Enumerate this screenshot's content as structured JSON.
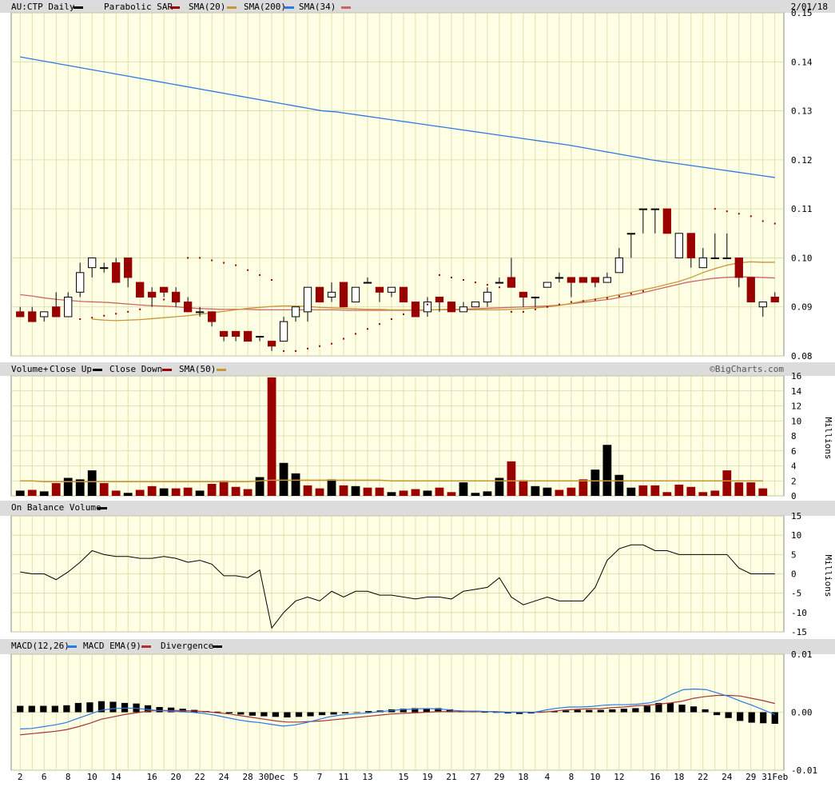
{
  "header": {
    "symbol_label": "AU:CTP Daily",
    "sar_label": "Parabolic SAR",
    "sma20_label": "SMA(20)",
    "sma200_label": "SMA(200)",
    "sma34_label": "SMA(34)",
    "date": "2/01/18"
  },
  "watermark": "©BigCharts.com",
  "colors": {
    "panel_bg": "#ffffe6",
    "grid": "#d8d8a0",
    "header_bg": "#dcdcdc",
    "up": "#000000",
    "down": "#990000",
    "sma20": "#c89632",
    "sma200": "#2a7ae2",
    "sma34": "#d06464",
    "sar": "#990000",
    "macd": "#2a7ae2",
    "macd_ema": "#aa3333"
  },
  "x_ticks": [
    "2",
    "6",
    "8",
    "10",
    "14",
    "16",
    "20",
    "22",
    "24",
    "28",
    "30Dec",
    "5",
    "7",
    "11",
    "13",
    "15",
    "19",
    "21",
    "27",
    "29",
    "18",
    "4",
    "8",
    "10",
    "12",
    "16",
    "18",
    "22",
    "24",
    "29",
    "31Feb"
  ],
  "chart_data": [
    {
      "type": "candlestick",
      "title": "AU:CTP Daily",
      "ylim": [
        0.08,
        0.15
      ],
      "yticks": [
        "0.15",
        "0.14",
        "0.13",
        "0.12",
        "0.11",
        "0.10",
        "0.09",
        "0.08"
      ],
      "ohlc": [
        [
          0.089,
          0.09,
          0.088,
          0.088
        ],
        [
          0.089,
          0.09,
          0.087,
          0.087
        ],
        [
          0.088,
          0.089,
          0.087,
          0.089
        ],
        [
          0.09,
          0.093,
          0.088,
          0.088
        ],
        [
          0.088,
          0.093,
          0.088,
          0.092
        ],
        [
          0.093,
          0.099,
          0.092,
          0.097
        ],
        [
          0.098,
          0.1,
          0.096,
          0.1
        ],
        [
          0.098,
          0.099,
          0.097,
          0.098
        ],
        [
          0.099,
          0.1,
          0.096,
          0.095
        ],
        [
          0.1,
          0.1,
          0.094,
          0.096
        ],
        [
          0.095,
          0.095,
          0.092,
          0.092
        ],
        [
          0.093,
          0.094,
          0.09,
          0.092
        ],
        [
          0.094,
          0.094,
          0.092,
          0.093
        ],
        [
          0.093,
          0.094,
          0.09,
          0.091
        ],
        [
          0.091,
          0.092,
          0.089,
          0.089
        ],
        [
          0.089,
          0.09,
          0.088,
          0.089
        ],
        [
          0.089,
          0.089,
          0.086,
          0.087
        ],
        [
          0.085,
          0.085,
          0.083,
          0.084
        ],
        [
          0.085,
          0.085,
          0.083,
          0.084
        ],
        [
          0.085,
          0.085,
          0.083,
          0.083
        ],
        [
          0.084,
          0.084,
          0.083,
          0.084
        ],
        [
          0.083,
          0.083,
          0.081,
          0.082
        ],
        [
          0.083,
          0.088,
          0.083,
          0.087
        ],
        [
          0.088,
          0.09,
          0.087,
          0.09
        ],
        [
          0.089,
          0.094,
          0.087,
          0.094
        ],
        [
          0.094,
          0.094,
          0.091,
          0.091
        ],
        [
          0.092,
          0.095,
          0.091,
          0.093
        ],
        [
          0.095,
          0.095,
          0.09,
          0.09
        ],
        [
          0.091,
          0.094,
          0.091,
          0.094
        ],
        [
          0.095,
          0.096,
          0.095,
          0.095
        ],
        [
          0.094,
          0.094,
          0.091,
          0.093
        ],
        [
          0.093,
          0.094,
          0.092,
          0.094
        ],
        [
          0.094,
          0.094,
          0.091,
          0.091
        ],
        [
          0.091,
          0.091,
          0.088,
          0.088
        ],
        [
          0.089,
          0.092,
          0.088,
          0.091
        ],
        [
          0.092,
          0.092,
          0.089,
          0.091
        ],
        [
          0.091,
          0.091,
          0.089,
          0.089
        ],
        [
          0.089,
          0.091,
          0.089,
          0.09
        ],
        [
          0.09,
          0.091,
          0.09,
          0.091
        ],
        [
          0.091,
          0.094,
          0.09,
          0.093
        ],
        [
          0.095,
          0.096,
          0.095,
          0.095
        ],
        [
          0.096,
          0.1,
          0.094,
          0.094
        ],
        [
          0.093,
          0.093,
          0.09,
          0.092
        ],
        [
          0.092,
          0.092,
          0.09,
          0.092
        ],
        [
          0.094,
          0.095,
          0.094,
          0.095
        ],
        [
          0.096,
          0.097,
          0.095,
          0.096
        ],
        [
          0.096,
          0.096,
          0.092,
          0.095
        ],
        [
          0.096,
          0.096,
          0.095,
          0.095
        ],
        [
          0.096,
          0.096,
          0.094,
          0.095
        ],
        [
          0.095,
          0.097,
          0.095,
          0.096
        ],
        [
          0.097,
          0.102,
          0.097,
          0.1
        ],
        [
          0.105,
          0.105,
          0.1,
          0.105
        ],
        [
          0.11,
          0.11,
          0.105,
          0.11
        ],
        [
          0.11,
          0.11,
          0.105,
          0.11
        ],
        [
          0.11,
          0.11,
          0.105,
          0.105
        ],
        [
          0.1,
          0.105,
          0.1,
          0.105
        ],
        [
          0.105,
          0.105,
          0.098,
          0.1
        ],
        [
          0.098,
          0.102,
          0.098,
          0.1
        ],
        [
          0.1,
          0.105,
          0.1,
          0.1
        ],
        [
          0.1,
          0.105,
          0.1,
          0.1
        ],
        [
          0.1,
          0.1,
          0.094,
          0.096
        ],
        [
          0.096,
          0.096,
          0.091,
          0.091
        ],
        [
          0.09,
          0.091,
          0.088,
          0.091
        ],
        [
          0.092,
          0.093,
          0.091,
          0.091
        ]
      ],
      "sma200": [
        0.141,
        0.1405,
        0.14,
        0.1395,
        0.139,
        0.1385,
        0.138,
        0.1375,
        0.137,
        0.1365,
        0.136,
        0.1355,
        0.135,
        0.1345,
        0.134,
        0.1335,
        0.133,
        0.1325,
        0.132,
        0.1315,
        0.131,
        0.1305,
        0.13,
        0.1298,
        0.1294,
        0.129,
        0.1286,
        0.1282,
        0.1278,
        0.1274,
        0.127,
        0.1266,
        0.1262,
        0.1258,
        0.1254,
        0.125,
        0.1246,
        0.1242,
        0.1238,
        0.1234,
        0.123,
        0.1225,
        0.122,
        0.1215,
        0.121,
        0.1205,
        0.12,
        0.1196,
        0.1192,
        0.1188,
        0.1184,
        0.118,
        0.1176,
        0.1172,
        0.1168,
        0.1164
      ],
      "sma200_start": 0,
      "sma20": [
        0.0875,
        0.0873,
        0.0872,
        0.0873,
        0.0874,
        0.0876,
        0.0878,
        0.088,
        0.0882,
        0.0885,
        0.0888,
        0.0891,
        0.0894,
        0.0897,
        0.0899,
        0.0901,
        0.0902,
        0.0902,
        0.0901,
        0.0899,
        0.0898,
        0.0897,
        0.0896,
        0.0895,
        0.0895,
        0.0894,
        0.0894,
        0.0894,
        0.0894,
        0.0894,
        0.0894,
        0.0894,
        0.0894,
        0.0894,
        0.0894,
        0.0895,
        0.0896,
        0.0898,
        0.09,
        0.0903,
        0.0907,
        0.0912,
        0.0916,
        0.092,
        0.0925,
        0.093,
        0.0935,
        0.094,
        0.0946,
        0.0952,
        0.096,
        0.097,
        0.0978,
        0.0985,
        0.099,
        0.0992,
        0.0991,
        0.0991
      ],
      "sma20_start": 6,
      "sma34": [
        0.0925,
        0.0922,
        0.0918,
        0.0915,
        0.0913,
        0.0911,
        0.091,
        0.0909,
        0.0907,
        0.0905,
        0.0903,
        0.0902,
        0.0901,
        0.0899,
        0.0897,
        0.0896,
        0.0895,
        0.0895,
        0.0895,
        0.0894,
        0.0894,
        0.0894,
        0.0894,
        0.0894,
        0.0894,
        0.0894,
        0.0893,
        0.0893,
        0.0893,
        0.0893,
        0.0893,
        0.0893,
        0.0893,
        0.0894,
        0.0895,
        0.0895,
        0.0896,
        0.0897,
        0.0898,
        0.0899,
        0.09,
        0.0901,
        0.0902,
        0.0904,
        0.0907,
        0.091,
        0.0913,
        0.0916,
        0.0921,
        0.0926,
        0.0932,
        0.0938,
        0.0944,
        0.095,
        0.0954,
        0.0958,
        0.096,
        0.0961,
        0.0961,
        0.096,
        0.0959
      ],
      "sma34_start": 0,
      "sar": [
        null,
        null,
        null,
        null,
        null,
        0.0875,
        0.0878,
        0.0882,
        0.0886,
        0.089,
        0.0895,
        0.092,
        0.0915,
        0.091,
        0.1,
        0.1,
        0.0995,
        0.099,
        0.0985,
        0.0975,
        0.0965,
        0.0955,
        0.081,
        0.081,
        0.0815,
        0.082,
        0.0825,
        0.0835,
        0.0845,
        0.0855,
        0.0865,
        0.0875,
        0.0885,
        0.0895,
        0.0905,
        0.0965,
        0.096,
        0.0955,
        0.095,
        0.0945,
        0.094,
        0.089,
        0.089,
        0.0895,
        0.09,
        0.0905,
        0.091,
        0.0912,
        0.0915,
        0.0918,
        0.0922,
        0.0927,
        0.0932,
        null,
        null,
        null,
        null,
        null,
        0.11,
        0.1095,
        0.109,
        0.1085,
        0.1075,
        0.107
      ]
    },
    {
      "type": "bar",
      "title": "Volume+",
      "legend": [
        "Close Up",
        "Close Down",
        "SMA(50)"
      ],
      "unit": "Millions",
      "ylim": [
        0,
        16
      ],
      "yticks": [
        "16",
        "14",
        "12",
        "10",
        "8",
        "6",
        "4",
        "2",
        "0"
      ],
      "values": [
        0.7,
        0.8,
        0.6,
        1.7,
        2.4,
        2.2,
        3.4,
        1.7,
        0.7,
        0.4,
        0.8,
        1.3,
        1.0,
        1.0,
        1.1,
        0.7,
        1.6,
        2.0,
        1.2,
        0.9,
        2.5,
        15.8,
        4.4,
        3.0,
        1.4,
        1.0,
        2.2,
        1.4,
        1.3,
        1.1,
        1.1,
        0.5,
        0.7,
        0.9,
        0.7,
        1.1,
        0.5,
        1.8,
        0.4,
        0.6,
        2.4,
        4.6,
        2.1,
        1.3,
        1.1,
        0.8,
        1.1,
        2.2,
        3.5,
        6.8,
        2.8,
        1.1,
        1.4,
        1.4,
        0.5,
        1.5,
        1.2,
        0.5,
        0.7,
        3.4,
        1.8,
        1.8,
        1.0
      ],
      "up": [
        1,
        0,
        1,
        0,
        1,
        1,
        1,
        0,
        0,
        1,
        0,
        0,
        1,
        0,
        0,
        1,
        0,
        0,
        0,
        0,
        1,
        0,
        1,
        1,
        0,
        0,
        1,
        0,
        1,
        0,
        0,
        1,
        0,
        0,
        1,
        0,
        0,
        1,
        1,
        1,
        1,
        0,
        0,
        1,
        1,
        0,
        0,
        0,
        1,
        1,
        1,
        1,
        0,
        0,
        0,
        0,
        0,
        0,
        0,
        0,
        0,
        0,
        0
      ],
      "sma50": [
        2.0,
        2.0,
        1.9,
        1.9,
        1.9,
        1.9,
        1.9,
        1.9,
        1.9,
        1.9,
        1.9,
        1.9,
        1.9,
        1.9,
        1.9,
        1.9,
        1.9,
        1.9,
        1.9,
        1.9,
        2.0,
        2.1,
        2.1,
        2.1,
        2.1,
        2.1,
        2.1,
        2.1,
        2.1,
        2.1,
        2.1,
        2.0,
        2.0,
        2.0,
        2.0,
        2.0,
        2.0,
        2.0,
        2.0,
        2.0,
        2.0,
        2.0,
        2.0,
        2.0,
        2.0,
        2.0,
        2.0,
        2.0,
        2.0,
        2.0,
        2.0,
        2.0,
        2.0,
        2.0,
        2.0,
        2.0,
        2.0,
        2.0,
        2.0,
        2.0,
        2.0,
        2.0,
        2.0
      ]
    },
    {
      "type": "line",
      "title": "On Balance Volume",
      "unit": "Millions",
      "ylim": [
        -15,
        15
      ],
      "yticks": [
        "15",
        "10",
        "5",
        "0",
        "-5",
        "-10",
        "-15"
      ],
      "values": [
        0.5,
        0,
        0,
        -1.5,
        0.5,
        3,
        6,
        5,
        4.5,
        4.5,
        4,
        4,
        4.5,
        4,
        3,
        3.5,
        2.5,
        -0.5,
        -0.5,
        -1,
        1,
        -14,
        -10,
        -7,
        -6,
        -7,
        -4.5,
        -6,
        -4.5,
        -4.5,
        -5.5,
        -5.5,
        -6,
        -6.5,
        -6,
        -6,
        -6.5,
        -4.5,
        -4,
        -3.5,
        -1,
        -6,
        -8,
        -7,
        -6,
        -7,
        -7,
        -7,
        -3.5,
        3.5,
        6.5,
        7.5,
        7.5,
        6,
        6,
        5,
        5,
        5,
        5,
        5,
        1.5,
        0,
        0,
        0
      ]
    },
    {
      "type": "bar",
      "title": "MACD(12,26)",
      "legend": [
        "MACD EMA(9)",
        "Divergence"
      ],
      "ylim": [
        -0.01,
        0.01
      ],
      "yticks": [
        "0.01",
        "0.00",
        "-0.01"
      ],
      "divergence": [
        0.0011,
        0.0011,
        0.0011,
        0.0011,
        0.0012,
        0.0016,
        0.0017,
        0.0019,
        0.0018,
        0.0016,
        0.0015,
        0.0012,
        0.0009,
        0.0008,
        0.0006,
        0.0004,
        0.0002,
        0.0001,
        -0.0002,
        -0.0004,
        -0.0006,
        -0.0007,
        -0.0008,
        -0.0009,
        -0.0008,
        -0.0007,
        -0.0005,
        -0.0004,
        -0.0002,
        0,
        0.0002,
        0.0003,
        0.0005,
        0.0006,
        0.0007,
        0.0007,
        0.0007,
        0.0005,
        0.0002,
        0.0001,
        0,
        -0.0001,
        -0.0002,
        -0.0003,
        -0.0002,
        0.0001,
        0.0002,
        0.0003,
        0.0004,
        0.0004,
        0.0004,
        0.0005,
        0.0006,
        0.0007,
        0.0011,
        0.0016,
        0.0016,
        0.0013,
        0.001,
        0.0005,
        -0.0005,
        -0.001,
        -0.0015,
        -0.0018,
        -0.0019,
        -0.002
      ],
      "macd": [
        -0.0029,
        -0.0028,
        -0.0025,
        -0.0022,
        -0.0018,
        -0.0011,
        -0.0004,
        0.0003,
        0.0006,
        0.0007,
        0.0007,
        0.0005,
        0.0003,
        0.0002,
        0.0001,
        0,
        -0.0002,
        -0.0005,
        -0.0009,
        -0.0013,
        -0.0016,
        -0.0018,
        -0.0021,
        -0.0024,
        -0.0022,
        -0.0018,
        -0.0013,
        -0.0008,
        -0.0005,
        -0.0003,
        -0.0002,
        0,
        0.0002,
        0.0004,
        0.0005,
        0.0006,
        0.0006,
        0.0005,
        0.0003,
        0.0002,
        0.0002,
        0.0001,
        0,
        0,
        0,
        0,
        0.0004,
        0.0007,
        0.0009,
        0.0009,
        0.001,
        0.0012,
        0.0013,
        0.0013,
        0.0014,
        0.0016,
        0.0021,
        0.0031,
        0.0039,
        0.004,
        0.0039,
        0.0033,
        0.0027,
        0.0019,
        0.0012,
        0.0004,
        -0.0004
      ],
      "macd_ema": [
        -0.0039,
        -0.0037,
        -0.0035,
        -0.0033,
        -0.003,
        -0.0025,
        -0.0019,
        -0.0012,
        -0.0008,
        -0.0004,
        -0.0001,
        0.0002,
        0.0003,
        0.0003,
        0.0003,
        0.0002,
        0.0001,
        -0.0001,
        -0.0003,
        -0.0006,
        -0.0009,
        -0.0012,
        -0.0015,
        -0.0017,
        -0.0017,
        -0.0016,
        -0.0015,
        -0.0013,
        -0.0011,
        -0.0009,
        -0.0007,
        -0.0005,
        -0.0003,
        -0.0002,
        -0.0001,
        0,
        0.0001,
        0.0001,
        0.0001,
        0.0001,
        0.0001,
        0.0001,
        0,
        0,
        0,
        0,
        0.0002,
        0.0004,
        0.0005,
        0.0006,
        0.0006,
        0.0008,
        0.0009,
        0.0011,
        0.0012,
        0.0014,
        0.0016,
        0.0019,
        0.0024,
        0.0027,
        0.0029,
        0.0029,
        0.0028,
        0.0024,
        0.002,
        0.0015
      ]
    }
  ]
}
